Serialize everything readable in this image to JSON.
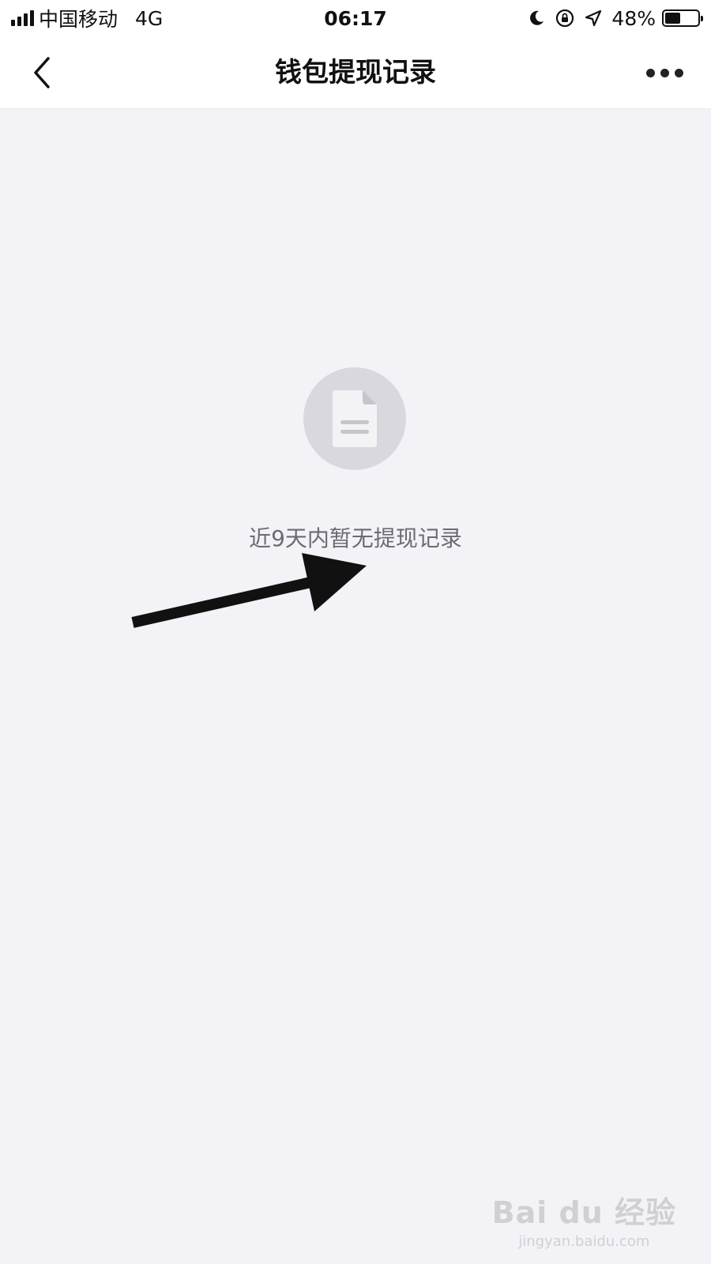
{
  "status_bar": {
    "carrier": "中国移动",
    "network": "4G",
    "time": "06:17",
    "battery_percent_label": "48%",
    "battery_level": 0.48,
    "icons": [
      "signal-icon",
      "moon-icon",
      "orientation-lock-icon",
      "location-icon",
      "battery-icon"
    ]
  },
  "nav": {
    "title": "钱包提现记录",
    "back_icon": "chevron-left-icon",
    "more_icon": "more-dots-icon"
  },
  "empty_state": {
    "icon": "document-icon",
    "message": "近9天内暂无提现记录"
  },
  "annotation": {
    "icon": "arrow-icon"
  },
  "watermark": {
    "brand": "Bai du 经验",
    "url": "jingyan.baidu.com"
  },
  "colors": {
    "background": "#f3f3f7",
    "bar": "#ffffff",
    "icon_circle": "#d8d8de",
    "muted_text": "#6b6b72"
  }
}
